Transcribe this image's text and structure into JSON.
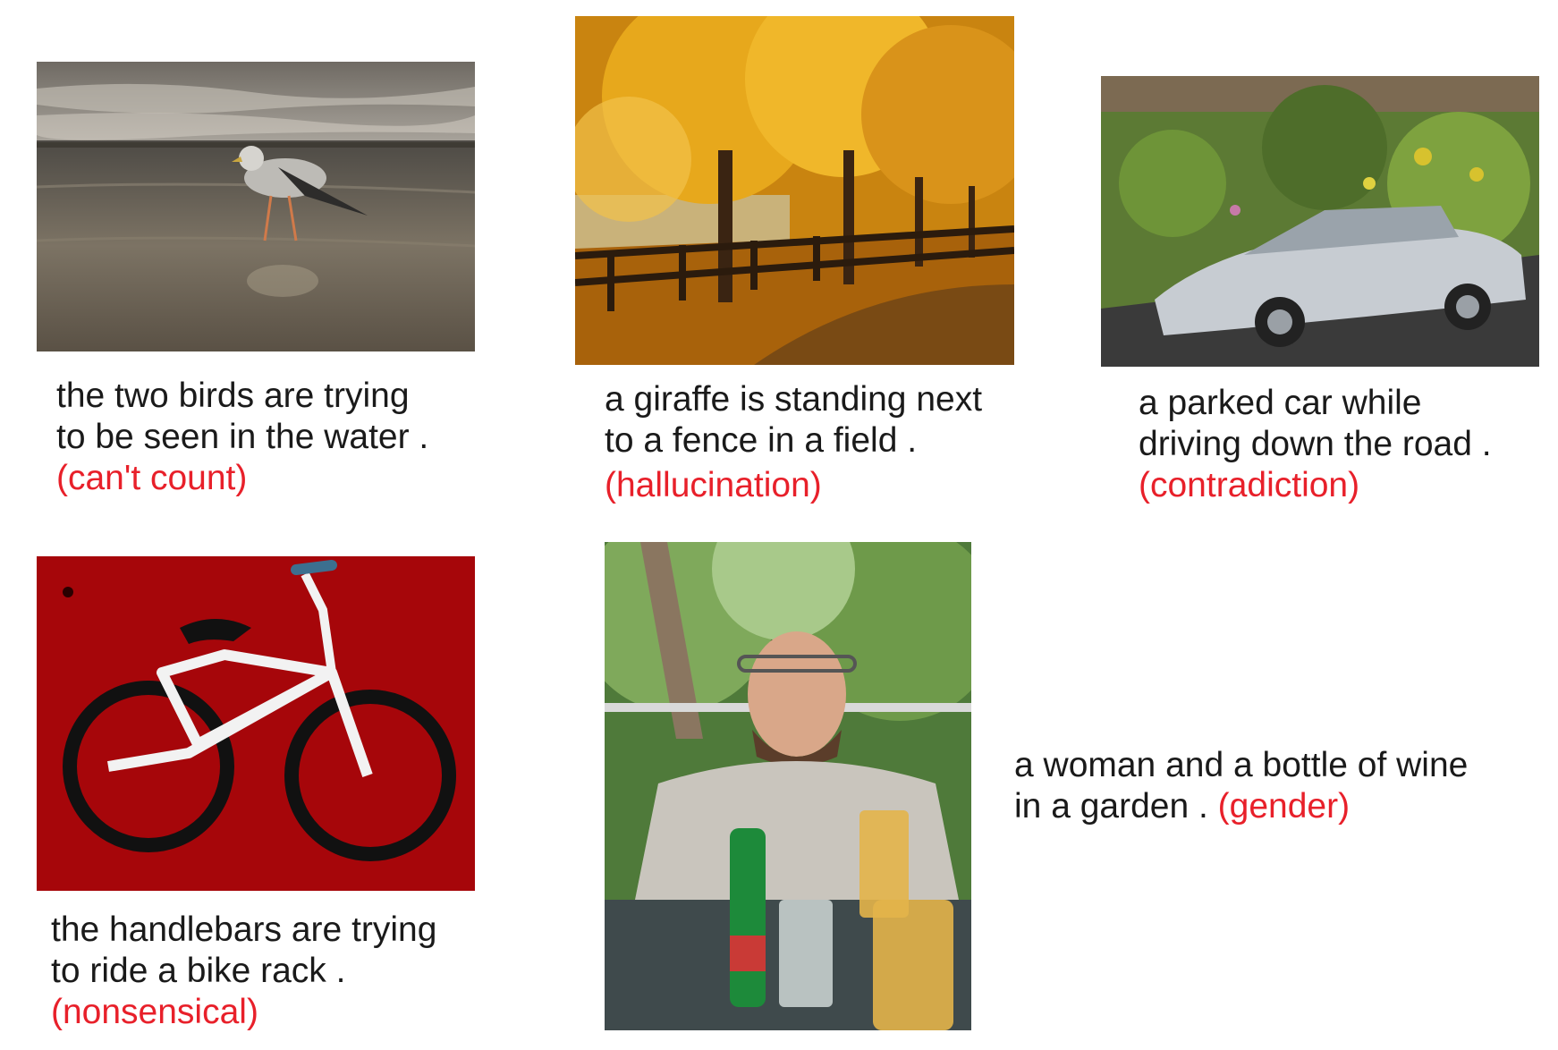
{
  "colors": {
    "caption_text": "#1a1a1a",
    "error_tag": "#e8202a",
    "background": "#ffffff"
  },
  "examples": [
    {
      "image": "seagull on wet beach",
      "caption_lines": [
        "the two birds are trying",
        "to be seen in the water ."
      ],
      "error_tag": "(can't count)"
    },
    {
      "image": "autumn trees along a wooden fence",
      "caption_lines": [
        "a giraffe is standing next",
        "to a fence in a field ."
      ],
      "error_tag": "(hallucination)"
    },
    {
      "image": "silver sedan on a road",
      "caption_lines": [
        "a parked car while",
        "driving down the road ."
      ],
      "error_tag": "(contradiction)"
    },
    {
      "image": "white bmx bike on red wall",
      "caption_lines": [
        "the handlebars are trying",
        "to ride a bike rack ."
      ],
      "error_tag": "(nonsensical)"
    },
    {
      "image": "smiling man at table with drinks",
      "caption_lines": [
        "a woman and a bottle of wine",
        "in a garden ."
      ],
      "error_tag": "(gender)"
    }
  ]
}
